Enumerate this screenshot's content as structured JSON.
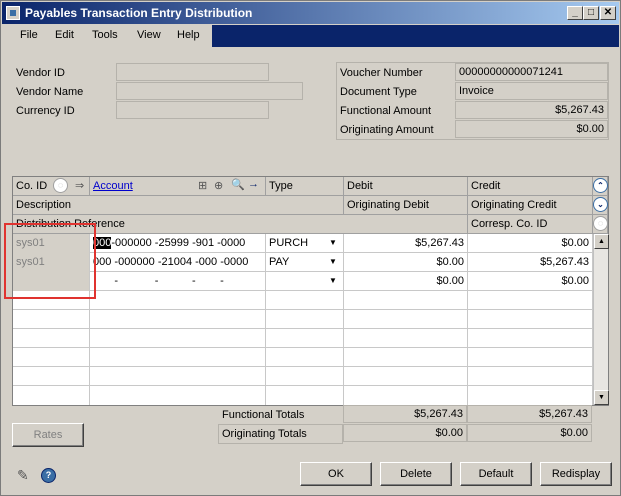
{
  "window": {
    "title": "Payables Transaction Entry Distribution"
  },
  "menu": [
    "File",
    "Edit",
    "Tools",
    "View",
    "Help"
  ],
  "header_left": [
    {
      "label": "Vendor ID",
      "value": ""
    },
    {
      "label": "Vendor Name",
      "value": ""
    },
    {
      "label": "Currency ID",
      "value": ""
    }
  ],
  "header_right": [
    {
      "label": "Voucher Number",
      "value": "00000000000071241"
    },
    {
      "label": "Document Type",
      "value": "Invoice"
    },
    {
      "label": "Functional Amount",
      "value": "$5,267.43"
    },
    {
      "label": "Originating Amount",
      "value": "$0.00"
    }
  ],
  "grid": {
    "headers": {
      "co_id": "Co. ID",
      "account": "Account",
      "type": "Type",
      "debit": "Debit",
      "credit": "Credit",
      "description": "Description",
      "originating_debit": "Originating Debit",
      "originating_credit": "Originating Credit",
      "distribution_reference": "Distribution Reference",
      "corresp_co_id": "Corresp. Co. ID"
    },
    "rows": [
      {
        "co_id": "sys01",
        "account_sel": "000",
        "account_rest": "-000000 -25999 -901 -0000",
        "type": "PURCH",
        "debit": "$5,267.43",
        "credit": "$0.00"
      },
      {
        "co_id": "sys01",
        "account_sel": "",
        "account_rest": "000 -000000 -21004 -000 -0000",
        "type": "PAY",
        "debit": "$0.00",
        "credit": "$5,267.43"
      },
      {
        "co_id": "",
        "account_sel": "",
        "account_rest": "       -            -           -        -",
        "type": "",
        "debit": "$0.00",
        "credit": "$0.00"
      }
    ]
  },
  "totals": {
    "functional_label": "Functional Totals",
    "functional_debit": "$5,267.43",
    "functional_credit": "$5,267.43",
    "originating_label": "Originating Totals",
    "originating_debit": "$0.00",
    "originating_credit": "$0.00"
  },
  "buttons": {
    "rates": "Rates",
    "ok": "OK",
    "delete": "Delete",
    "default": "Default",
    "redisplay": "Redisplay"
  },
  "colors": {
    "title_start": "#0a246a",
    "title_end": "#a6caf0",
    "highlight": "#e0332f"
  }
}
